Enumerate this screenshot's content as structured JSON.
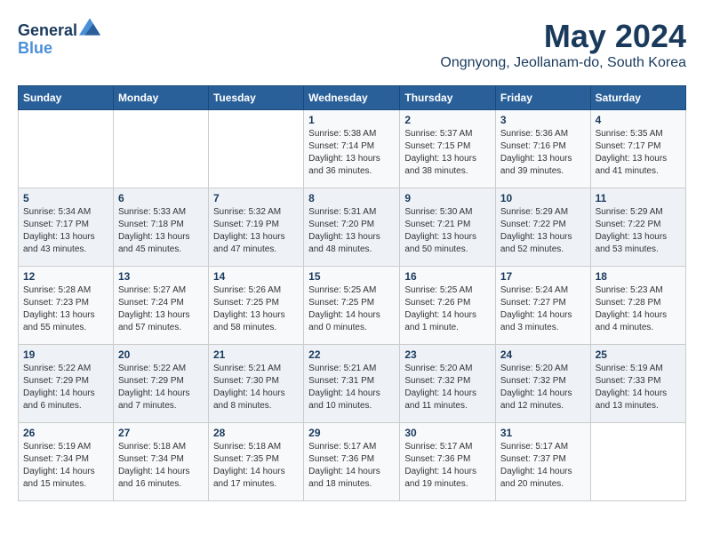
{
  "header": {
    "logo_line1": "General",
    "logo_line2": "Blue",
    "month": "May 2024",
    "location": "Ongnyong, Jeollanam-do, South Korea"
  },
  "days_of_week": [
    "Sunday",
    "Monday",
    "Tuesday",
    "Wednesday",
    "Thursday",
    "Friday",
    "Saturday"
  ],
  "weeks": [
    [
      {
        "num": "",
        "info": ""
      },
      {
        "num": "",
        "info": ""
      },
      {
        "num": "",
        "info": ""
      },
      {
        "num": "1",
        "info": "Sunrise: 5:38 AM\nSunset: 7:14 PM\nDaylight: 13 hours\nand 36 minutes."
      },
      {
        "num": "2",
        "info": "Sunrise: 5:37 AM\nSunset: 7:15 PM\nDaylight: 13 hours\nand 38 minutes."
      },
      {
        "num": "3",
        "info": "Sunrise: 5:36 AM\nSunset: 7:16 PM\nDaylight: 13 hours\nand 39 minutes."
      },
      {
        "num": "4",
        "info": "Sunrise: 5:35 AM\nSunset: 7:17 PM\nDaylight: 13 hours\nand 41 minutes."
      }
    ],
    [
      {
        "num": "5",
        "info": "Sunrise: 5:34 AM\nSunset: 7:17 PM\nDaylight: 13 hours\nand 43 minutes."
      },
      {
        "num": "6",
        "info": "Sunrise: 5:33 AM\nSunset: 7:18 PM\nDaylight: 13 hours\nand 45 minutes."
      },
      {
        "num": "7",
        "info": "Sunrise: 5:32 AM\nSunset: 7:19 PM\nDaylight: 13 hours\nand 47 minutes."
      },
      {
        "num": "8",
        "info": "Sunrise: 5:31 AM\nSunset: 7:20 PM\nDaylight: 13 hours\nand 48 minutes."
      },
      {
        "num": "9",
        "info": "Sunrise: 5:30 AM\nSunset: 7:21 PM\nDaylight: 13 hours\nand 50 minutes."
      },
      {
        "num": "10",
        "info": "Sunrise: 5:29 AM\nSunset: 7:22 PM\nDaylight: 13 hours\nand 52 minutes."
      },
      {
        "num": "11",
        "info": "Sunrise: 5:29 AM\nSunset: 7:22 PM\nDaylight: 13 hours\nand 53 minutes."
      }
    ],
    [
      {
        "num": "12",
        "info": "Sunrise: 5:28 AM\nSunset: 7:23 PM\nDaylight: 13 hours\nand 55 minutes."
      },
      {
        "num": "13",
        "info": "Sunrise: 5:27 AM\nSunset: 7:24 PM\nDaylight: 13 hours\nand 57 minutes."
      },
      {
        "num": "14",
        "info": "Sunrise: 5:26 AM\nSunset: 7:25 PM\nDaylight: 13 hours\nand 58 minutes."
      },
      {
        "num": "15",
        "info": "Sunrise: 5:25 AM\nSunset: 7:25 PM\nDaylight: 14 hours\nand 0 minutes."
      },
      {
        "num": "16",
        "info": "Sunrise: 5:25 AM\nSunset: 7:26 PM\nDaylight: 14 hours\nand 1 minute."
      },
      {
        "num": "17",
        "info": "Sunrise: 5:24 AM\nSunset: 7:27 PM\nDaylight: 14 hours\nand 3 minutes."
      },
      {
        "num": "18",
        "info": "Sunrise: 5:23 AM\nSunset: 7:28 PM\nDaylight: 14 hours\nand 4 minutes."
      }
    ],
    [
      {
        "num": "19",
        "info": "Sunrise: 5:22 AM\nSunset: 7:29 PM\nDaylight: 14 hours\nand 6 minutes."
      },
      {
        "num": "20",
        "info": "Sunrise: 5:22 AM\nSunset: 7:29 PM\nDaylight: 14 hours\nand 7 minutes."
      },
      {
        "num": "21",
        "info": "Sunrise: 5:21 AM\nSunset: 7:30 PM\nDaylight: 14 hours\nand 8 minutes."
      },
      {
        "num": "22",
        "info": "Sunrise: 5:21 AM\nSunset: 7:31 PM\nDaylight: 14 hours\nand 10 minutes."
      },
      {
        "num": "23",
        "info": "Sunrise: 5:20 AM\nSunset: 7:32 PM\nDaylight: 14 hours\nand 11 minutes."
      },
      {
        "num": "24",
        "info": "Sunrise: 5:20 AM\nSunset: 7:32 PM\nDaylight: 14 hours\nand 12 minutes."
      },
      {
        "num": "25",
        "info": "Sunrise: 5:19 AM\nSunset: 7:33 PM\nDaylight: 14 hours\nand 13 minutes."
      }
    ],
    [
      {
        "num": "26",
        "info": "Sunrise: 5:19 AM\nSunset: 7:34 PM\nDaylight: 14 hours\nand 15 minutes."
      },
      {
        "num": "27",
        "info": "Sunrise: 5:18 AM\nSunset: 7:34 PM\nDaylight: 14 hours\nand 16 minutes."
      },
      {
        "num": "28",
        "info": "Sunrise: 5:18 AM\nSunset: 7:35 PM\nDaylight: 14 hours\nand 17 minutes."
      },
      {
        "num": "29",
        "info": "Sunrise: 5:17 AM\nSunset: 7:36 PM\nDaylight: 14 hours\nand 18 minutes."
      },
      {
        "num": "30",
        "info": "Sunrise: 5:17 AM\nSunset: 7:36 PM\nDaylight: 14 hours\nand 19 minutes."
      },
      {
        "num": "31",
        "info": "Sunrise: 5:17 AM\nSunset: 7:37 PM\nDaylight: 14 hours\nand 20 minutes."
      },
      {
        "num": "",
        "info": ""
      }
    ]
  ]
}
